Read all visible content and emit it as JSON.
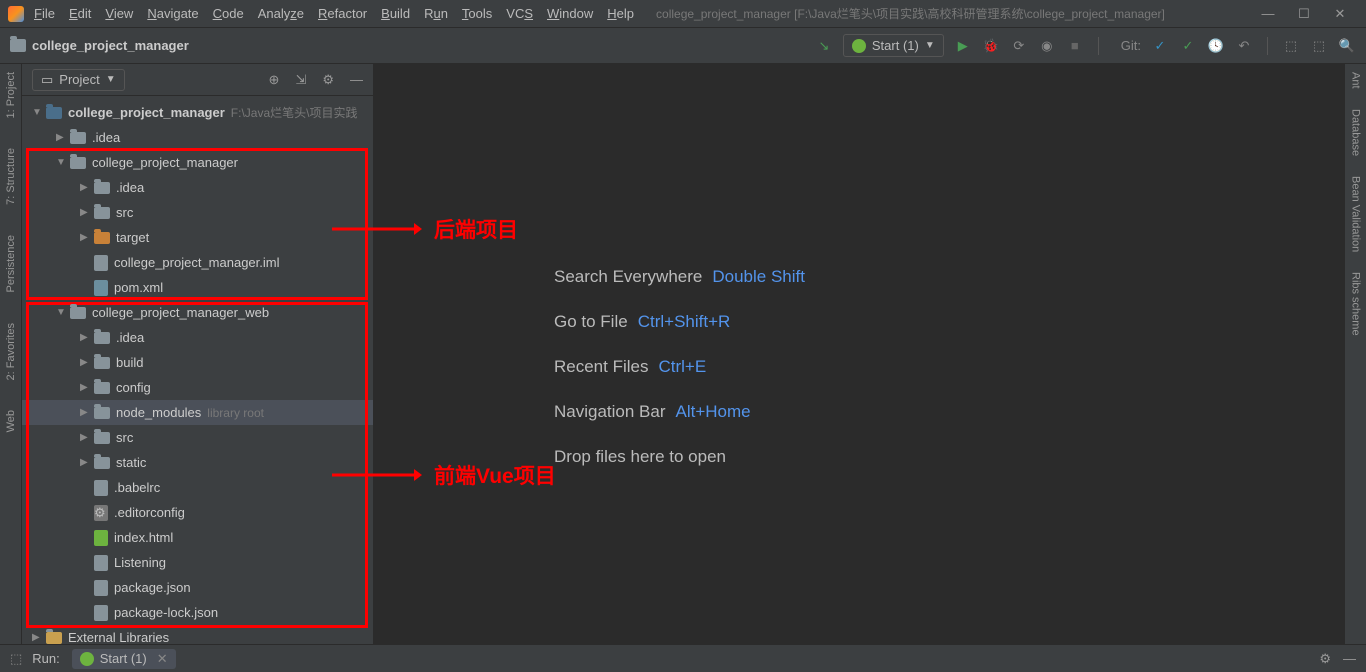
{
  "titlebar": {
    "menus": [
      "File",
      "Edit",
      "View",
      "Navigate",
      "Code",
      "Analyze",
      "Refactor",
      "Build",
      "Run",
      "Tools",
      "VCS",
      "Window",
      "Help"
    ],
    "path": "college_project_manager [F:\\Java烂笔头\\项目实践\\高校科研管理系统\\college_project_manager]"
  },
  "breadcrumb": {
    "label": "college_project_manager"
  },
  "toolbar": {
    "run_config": "Start (1)",
    "vcs_label": "Git:"
  },
  "sidebar": {
    "title": "Project",
    "root": {
      "label": "college_project_manager",
      "hint": "F:\\Java烂笔头\\项目实践"
    }
  },
  "tree": {
    "idea1": ".idea",
    "mod1": "college_project_manager",
    "idea2": ".idea",
    "src1": "src",
    "target": "target",
    "iml": "college_project_manager.iml",
    "pom": "pom.xml",
    "mod2": "college_project_manager_web",
    "idea3": ".idea",
    "build": "build",
    "config": "config",
    "nodemod": "node_modules",
    "nodemod_hint": "library root",
    "src2": "src",
    "static": "static",
    "babelrc": ".babelrc",
    "editorconfig": ".editorconfig",
    "indexhtml": "index.html",
    "listening": "Listening",
    "pkgjson": "package.json",
    "pkglockjson": "package-lock.json",
    "extlib": "External Libraries"
  },
  "welcome": {
    "rows": [
      {
        "label": "Search Everywhere",
        "shortcut": "Double Shift"
      },
      {
        "label": "Go to File",
        "shortcut": "Ctrl+Shift+R"
      },
      {
        "label": "Recent Files",
        "shortcut": "Ctrl+E"
      },
      {
        "label": "Navigation Bar",
        "shortcut": "Alt+Home"
      },
      {
        "label": "Drop files here to open",
        "shortcut": ""
      }
    ]
  },
  "annotations": {
    "backend": "后端项目",
    "frontend": "前端Vue项目"
  },
  "left_gutter": [
    "1: Project",
    "7: Structure",
    "Persistence",
    "2: Favorites",
    "Web"
  ],
  "right_gutter": [
    "Ant",
    "Database",
    "Bean Validation",
    "Ribs scheme"
  ],
  "statusbar": {
    "run": "Run:",
    "tab": "Start (1)"
  }
}
